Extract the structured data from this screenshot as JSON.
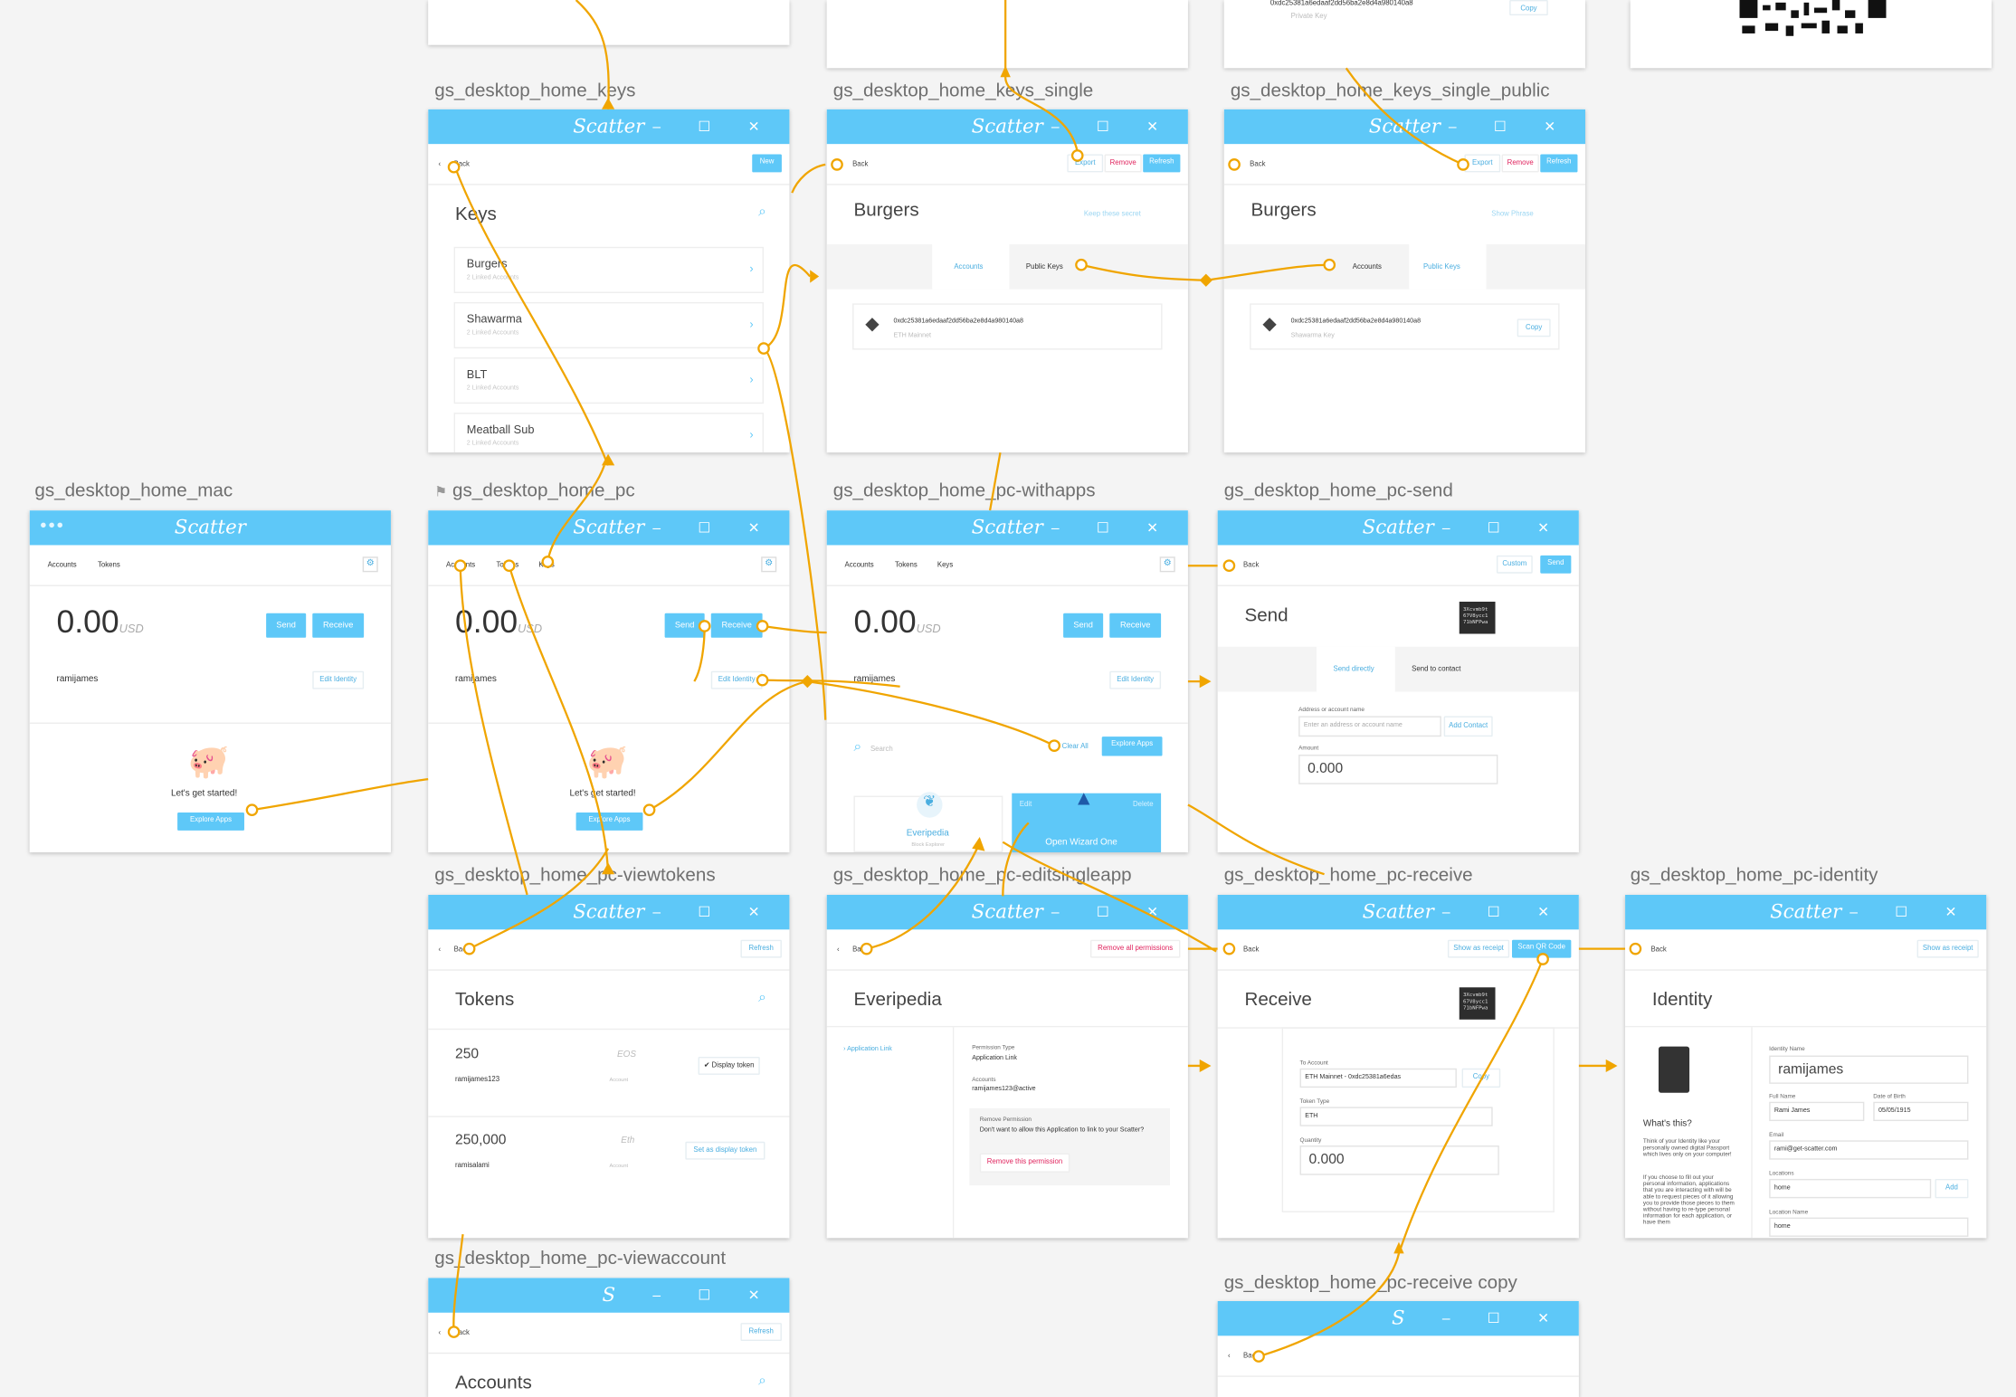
{
  "artboards": {
    "keys": "gs_desktop_home_keys",
    "keys_single": "gs_desktop_home_keys_single",
    "keys_single_public": "gs_desktop_home_keys_single_public",
    "mac": "gs_desktop_home_mac",
    "pc": "gs_desktop_home_pc",
    "withapps": "gs_desktop_home_pc-withapps",
    "send": "gs_desktop_home_pc-send",
    "viewtokens": "gs_desktop_home_pc-viewtokens",
    "editsingleapp": "gs_desktop_home_pc-editsingleapp",
    "receive": "gs_desktop_home_pc-receive",
    "identity": "gs_desktop_home_pc-identity",
    "viewaccount": "gs_desktop_home_pc-viewaccount",
    "receive_copy": "gs_desktop_home_pc-receive copy"
  },
  "app": {
    "logo": "Scatter",
    "logo_small": "S",
    "window_controls": "–  ☐  ✕"
  },
  "common": {
    "back": "Back",
    "refresh": "Refresh",
    "new": "New",
    "send": "Send",
    "receive": "Receive",
    "edit_identity": "Edit Identity",
    "export": "Export",
    "remove": "Remove",
    "copy": "Copy",
    "accounts": "Accounts",
    "tokens": "Tokens",
    "keys": "Keys",
    "public_keys": "Public Keys",
    "balance": "0.00",
    "currency": "USD",
    "username": "ramijames",
    "lets_start": "Let's get started!",
    "explore_apps": "Explore Apps",
    "address": "0xdc25381a6edaaf2dd56ba2e8d4a980140a8",
    "eth_mainnet": "ETH Mainnet",
    "shawarma_key": "Shawarma Key",
    "private_key": "Private Key"
  },
  "keys": {
    "title": "Keys",
    "items": [
      {
        "name": "Burgers",
        "sub": "2 Linked Accounts"
      },
      {
        "name": "Shawarma",
        "sub": "2 Linked Accounts"
      },
      {
        "name": "BLT",
        "sub": "2 Linked Accounts"
      },
      {
        "name": "Meatball Sub",
        "sub": "2 Linked Accounts"
      }
    ]
  },
  "keys_single": {
    "title": "Burgers",
    "secret": "Keep these secret",
    "show_phrase": "Show Phrase"
  },
  "withapps": {
    "search": "Search",
    "clear_all": "Clear All",
    "apps": [
      {
        "name": "Everipedia",
        "sub": "Block Explorer"
      },
      {
        "name": "Open Wizard One",
        "edit": "Edit",
        "delete": "Delete"
      }
    ]
  },
  "send": {
    "title": "Send",
    "custom": "Custom",
    "send_directly": "Send directly",
    "send_contact": "Send to contact",
    "addr_label": "Address or account name",
    "addr_placeholder": "Enter an address or account name",
    "add_contact": "Add Contact",
    "amount_label": "Amount",
    "amount": "0.000",
    "qr_text": "3Xcvmb9t\n67V8ycc1\n71bNFPwa"
  },
  "tokens": {
    "title": "Tokens",
    "rows": [
      {
        "amount": "250",
        "sym": "EOS",
        "acct": "ramijames123",
        "note": "Account",
        "action": "✔ Display token"
      },
      {
        "amount": "250,000",
        "sym": "Eth",
        "acct": "ramisalami",
        "note": "Account",
        "action": "Set as display token"
      }
    ]
  },
  "editapp": {
    "title": "Everipedia",
    "remove_all": "Remove all permissions",
    "link": "Application Link",
    "perm_type_label": "Permission Type",
    "perm_type": "Application Link",
    "accounts_label": "Accounts",
    "account": "ramijames123@active",
    "remove_perm_label": "Remove Permission",
    "remove_perm_text": "Don't want to allow this Application to link to your Scatter?",
    "remove_perm_btn": "Remove this permission"
  },
  "receive": {
    "title": "Receive",
    "show_receipt": "Show as receipt",
    "scan": "Scan QR Code",
    "to_account_label": "To Account",
    "to_account": "ETH Mainnet - 0xdc25381a6edas",
    "token_label": "Token Type",
    "token": "ETH",
    "qty_label": "Quantity",
    "qty": "0.000"
  },
  "identity": {
    "title": "Identity",
    "show_receipt": "Show as receipt",
    "whats": "What's this?",
    "desc": "Think of your Identity like your personally owned digital Passport which lives only on your computer!",
    "desc2": "If you choose to fill out your personal information, applications that you are interacting with will be able to request pieces of it allowing you to provide those pieces to them without having to re-type personal information for each application, or have them",
    "id_name_label": "Identity Name",
    "id_name": "ramijames",
    "full_name_label": "Full Name",
    "full_name": "Rami James",
    "dob_label": "Date of Birth",
    "dob": "05/05/1915",
    "email_label": "Email",
    "email": "rami@get-scatter.com",
    "locations_label": "Locations",
    "location": "home",
    "add": "Add",
    "location_name_label": "Location Name",
    "location_name": "home"
  },
  "viewaccount": {
    "title": "Accounts"
  }
}
